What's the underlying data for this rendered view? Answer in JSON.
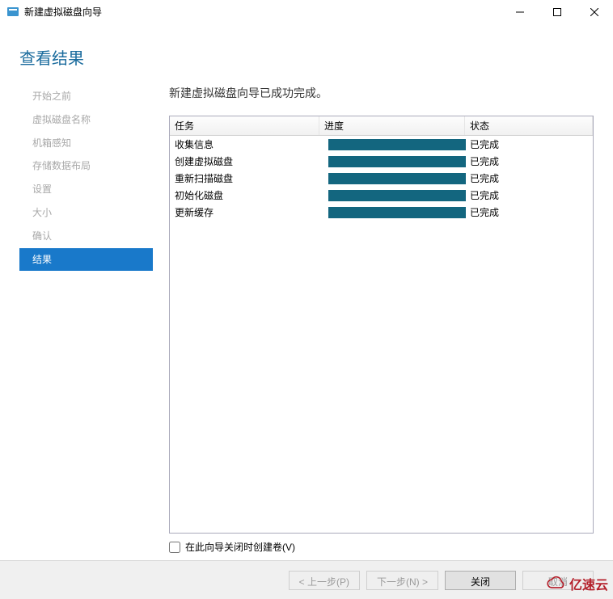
{
  "window": {
    "title": "新建虚拟磁盘向导"
  },
  "heading": "查看结果",
  "sidebar": {
    "items": [
      {
        "label": "开始之前"
      },
      {
        "label": "虚拟磁盘名称"
      },
      {
        "label": "机箱感知"
      },
      {
        "label": "存储数据布局"
      },
      {
        "label": "设置"
      },
      {
        "label": "大小"
      },
      {
        "label": "确认"
      },
      {
        "label": "结果",
        "active": true
      }
    ]
  },
  "main": {
    "message": "新建虚拟磁盘向导已成功完成。",
    "columns": {
      "task": "任务",
      "progress": "进度",
      "status": "状态"
    },
    "rows": [
      {
        "task": "收集信息",
        "status": "已完成"
      },
      {
        "task": "创建虚拟磁盘",
        "status": "已完成"
      },
      {
        "task": "重新扫描磁盘",
        "status": "已完成"
      },
      {
        "task": "初始化磁盘",
        "status": "已完成"
      },
      {
        "task": "更新缓存",
        "status": "已完成"
      }
    ],
    "checkbox_label": "在此向导关闭时创建卷(V)"
  },
  "footer": {
    "prev": "< 上一步(P)",
    "next": "下一步(N) >",
    "close": "关闭",
    "cancel": "取消"
  },
  "watermark": {
    "text": "亿速云"
  }
}
